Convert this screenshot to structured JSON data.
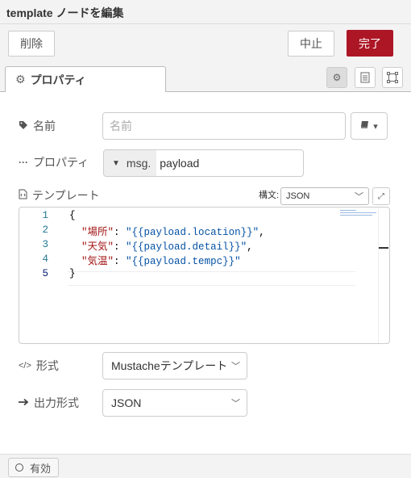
{
  "dialog": {
    "title": "template ノードを編集"
  },
  "buttons": {
    "delete": "削除",
    "cancel": "中止",
    "done": "完了"
  },
  "tab": {
    "label": "プロパティ",
    "icon": "gear-icon"
  },
  "tab_icons": [
    "settings-icon",
    "description-icon",
    "appearance-icon"
  ],
  "fields": {
    "name": {
      "label": "名前",
      "placeholder": "名前",
      "value": "",
      "icon": "tag-icon",
      "library_icon": "book-icon"
    },
    "property": {
      "label": "プロパティ",
      "prefix": "msg.",
      "value": "payload",
      "icon": "ellipsis-icon"
    },
    "template": {
      "label": "テンプレート",
      "icon": "file-code-icon",
      "syntax_label": "構文:",
      "syntax_value": "JSON"
    },
    "format": {
      "label": "形式",
      "value": "Mustacheテンプレート",
      "icon": "code-icon"
    },
    "output": {
      "label": "出力形式",
      "value": "JSON",
      "icon": "arrow-right-icon"
    }
  },
  "editor": {
    "lines": [
      {
        "num": "1",
        "indent": "",
        "key": "",
        "sep": "",
        "value": "",
        "text": "{"
      },
      {
        "num": "2",
        "indent": "  ",
        "key": "\"場所\"",
        "sep": ": ",
        "value": "\"{{payload.location}}\"",
        "text": ","
      },
      {
        "num": "3",
        "indent": "  ",
        "key": "\"天気\"",
        "sep": ": ",
        "value": "\"{{payload.detail}}\"",
        "text": ","
      },
      {
        "num": "4",
        "indent": "  ",
        "key": "\"気温\"",
        "sep": ": ",
        "value": "\"{{payload.tempc}}\"",
        "text": ""
      },
      {
        "num": "5",
        "indent": "",
        "key": "",
        "sep": "",
        "value": "",
        "text": "}"
      }
    ]
  },
  "footer": {
    "enabled_label": "有効"
  },
  "colors": {
    "done_button": "#ad1625",
    "json_key": "#a31515",
    "json_string": "#0451a5",
    "line_number": "#237893"
  }
}
